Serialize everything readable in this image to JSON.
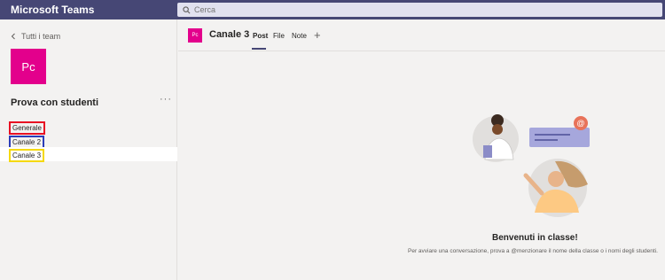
{
  "app": {
    "title": "Microsoft Teams"
  },
  "search": {
    "placeholder": "Cerca",
    "icon": "search-icon"
  },
  "sidebar": {
    "back_label": "Tutti i team",
    "team_avatar": "Pc",
    "team_name": "Prova con studenti",
    "more_label": "···",
    "channels": [
      {
        "label": "Generale"
      },
      {
        "label": "Canale 2"
      },
      {
        "label": "Canale 3",
        "selected": true
      }
    ]
  },
  "header": {
    "channel_icon": "Pc",
    "channel_title": "Canale 3",
    "tabs": [
      {
        "label": "Post",
        "active": true
      },
      {
        "label": "File"
      },
      {
        "label": "Note"
      }
    ],
    "add_tab_label": "+"
  },
  "welcome": {
    "title": "Benvenuti in classe!",
    "text": "Per avviare una conversazione, prova a @menzionare il nome della classe o i nomi degli studenti."
  },
  "colors": {
    "topbar": "#464775",
    "accent": "#e3008c",
    "generale_highlight": "#e81123",
    "canale2_highlight": "#2b3db8",
    "canale3_highlight": "#f5d90a"
  }
}
